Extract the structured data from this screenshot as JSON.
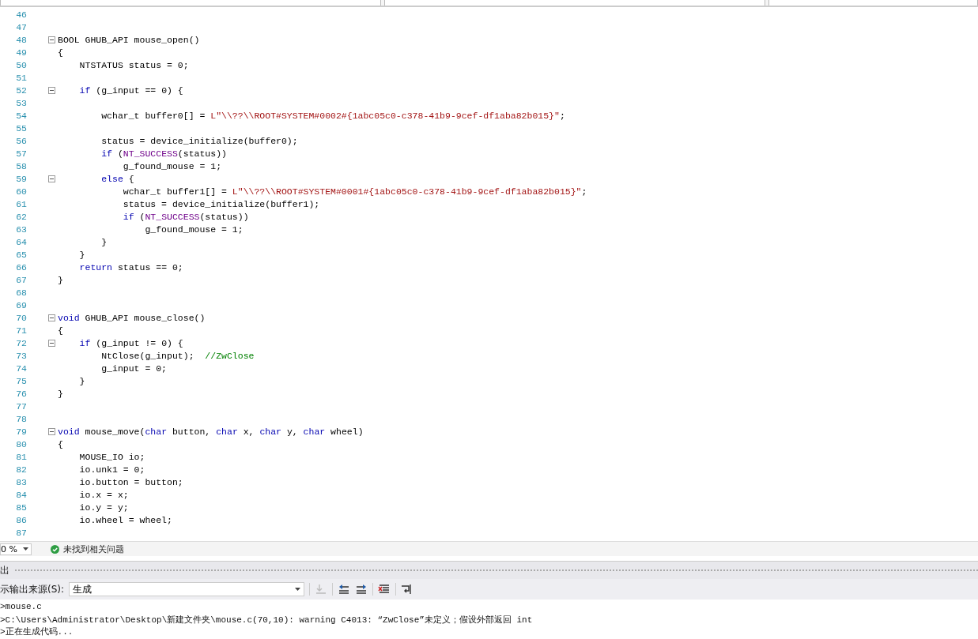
{
  "editor": {
    "lines": [
      {
        "num": "46",
        "fold": false
      },
      {
        "num": "47",
        "fold": false
      },
      {
        "num": "48",
        "fold": true,
        "tokens": [
          {
            "kind": "plain",
            "text": "BOOL GHUB_API mouse_open()"
          }
        ]
      },
      {
        "num": "49",
        "fold": false,
        "tokens": [
          {
            "kind": "plain",
            "text": "{"
          }
        ]
      },
      {
        "num": "50",
        "fold": false,
        "tokens": [
          {
            "kind": "plain",
            "text": "    NTSTATUS status = 0;"
          }
        ]
      },
      {
        "num": "51",
        "fold": false
      },
      {
        "num": "52",
        "fold": true,
        "tokens": [
          {
            "kind": "kw",
            "text": "    if"
          },
          {
            "kind": "plain",
            "text": " (g_input == 0) {"
          }
        ]
      },
      {
        "num": "53",
        "fold": false
      },
      {
        "num": "54",
        "fold": false,
        "tokens": [
          {
            "kind": "plain",
            "text": "        wchar_t buffer0[] = "
          },
          {
            "kind": "str",
            "text": "L\"\\\\??\\\\ROOT#SYSTEM#0002#{1abc05c0-c378-41b9-9cef-df1aba82b015}\""
          },
          {
            "kind": "plain",
            "text": ";"
          }
        ]
      },
      {
        "num": "55",
        "fold": false
      },
      {
        "num": "56",
        "fold": false,
        "tokens": [
          {
            "kind": "plain",
            "text": "        status = device_initialize(buffer0);"
          }
        ]
      },
      {
        "num": "57",
        "fold": false,
        "tokens": [
          {
            "kind": "kw",
            "text": "        if"
          },
          {
            "kind": "plain",
            "text": " ("
          },
          {
            "kind": "macro",
            "text": "NT_SUCCESS"
          },
          {
            "kind": "plain",
            "text": "(status))"
          }
        ]
      },
      {
        "num": "58",
        "fold": false,
        "tokens": [
          {
            "kind": "plain",
            "text": "            g_found_mouse = 1;"
          }
        ]
      },
      {
        "num": "59",
        "fold": true,
        "tokens": [
          {
            "kind": "kw",
            "text": "        else"
          },
          {
            "kind": "plain",
            "text": " {"
          }
        ]
      },
      {
        "num": "60",
        "fold": false,
        "tokens": [
          {
            "kind": "plain",
            "text": "            wchar_t buffer1[] = "
          },
          {
            "kind": "str",
            "text": "L\"\\\\??\\\\ROOT#SYSTEM#0001#{1abc05c0-c378-41b9-9cef-df1aba82b015}\""
          },
          {
            "kind": "plain",
            "text": ";"
          }
        ]
      },
      {
        "num": "61",
        "fold": false,
        "tokens": [
          {
            "kind": "plain",
            "text": "            status = device_initialize(buffer1);"
          }
        ]
      },
      {
        "num": "62",
        "fold": false,
        "tokens": [
          {
            "kind": "kw",
            "text": "            if"
          },
          {
            "kind": "plain",
            "text": " ("
          },
          {
            "kind": "macro",
            "text": "NT_SUCCESS"
          },
          {
            "kind": "plain",
            "text": "(status))"
          }
        ]
      },
      {
        "num": "63",
        "fold": false,
        "tokens": [
          {
            "kind": "plain",
            "text": "                g_found_mouse = 1;"
          }
        ]
      },
      {
        "num": "64",
        "fold": false,
        "tokens": [
          {
            "kind": "plain",
            "text": "        }"
          }
        ]
      },
      {
        "num": "65",
        "fold": false,
        "tokens": [
          {
            "kind": "plain",
            "text": "    }"
          }
        ]
      },
      {
        "num": "66",
        "fold": false,
        "tokens": [
          {
            "kind": "kw",
            "text": "    return"
          },
          {
            "kind": "plain",
            "text": " status == 0;"
          }
        ]
      },
      {
        "num": "67",
        "fold": false,
        "tokens": [
          {
            "kind": "plain",
            "text": "}"
          }
        ]
      },
      {
        "num": "68",
        "fold": false
      },
      {
        "num": "69",
        "fold": false
      },
      {
        "num": "70",
        "fold": true,
        "tokens": [
          {
            "kind": "kw",
            "text": "void"
          },
          {
            "kind": "plain",
            "text": " GHUB_API mouse_close()"
          }
        ]
      },
      {
        "num": "71",
        "fold": false,
        "tokens": [
          {
            "kind": "plain",
            "text": "{"
          }
        ]
      },
      {
        "num": "72",
        "fold": true,
        "tokens": [
          {
            "kind": "kw",
            "text": "    if"
          },
          {
            "kind": "plain",
            "text": " (g_input != 0) {"
          }
        ]
      },
      {
        "num": "73",
        "fold": false,
        "tokens": [
          {
            "kind": "plain",
            "text": "        NtClose(g_input);  "
          },
          {
            "kind": "comment",
            "text": "//ZwClose"
          }
        ]
      },
      {
        "num": "74",
        "fold": false,
        "tokens": [
          {
            "kind": "plain",
            "text": "        g_input = 0;"
          }
        ]
      },
      {
        "num": "75",
        "fold": false,
        "tokens": [
          {
            "kind": "plain",
            "text": "    }"
          }
        ]
      },
      {
        "num": "76",
        "fold": false,
        "tokens": [
          {
            "kind": "plain",
            "text": "}"
          }
        ]
      },
      {
        "num": "77",
        "fold": false
      },
      {
        "num": "78",
        "fold": false
      },
      {
        "num": "79",
        "fold": true,
        "tokens": [
          {
            "kind": "kw",
            "text": "void"
          },
          {
            "kind": "plain",
            "text": " mouse_move("
          },
          {
            "kind": "kw",
            "text": "char"
          },
          {
            "kind": "plain",
            "text": " button, "
          },
          {
            "kind": "kw",
            "text": "char"
          },
          {
            "kind": "plain",
            "text": " x, "
          },
          {
            "kind": "kw",
            "text": "char"
          },
          {
            "kind": "plain",
            "text": " y, "
          },
          {
            "kind": "kw",
            "text": "char"
          },
          {
            "kind": "plain",
            "text": " wheel)"
          }
        ]
      },
      {
        "num": "80",
        "fold": false,
        "tokens": [
          {
            "kind": "plain",
            "text": "{"
          }
        ]
      },
      {
        "num": "81",
        "fold": false,
        "tokens": [
          {
            "kind": "plain",
            "text": "    MOUSE_IO io;"
          }
        ]
      },
      {
        "num": "82",
        "fold": false,
        "tokens": [
          {
            "kind": "plain",
            "text": "    io.unk1 = 0;"
          }
        ]
      },
      {
        "num": "83",
        "fold": false,
        "tokens": [
          {
            "kind": "plain",
            "text": "    io.button = button;"
          }
        ]
      },
      {
        "num": "84",
        "fold": false,
        "tokens": [
          {
            "kind": "plain",
            "text": "    io.x = x;"
          }
        ]
      },
      {
        "num": "85",
        "fold": false,
        "tokens": [
          {
            "kind": "plain",
            "text": "    io.y = y;"
          }
        ]
      },
      {
        "num": "86",
        "fold": false,
        "tokens": [
          {
            "kind": "plain",
            "text": "    io.wheel = wheel;"
          }
        ]
      },
      {
        "num": "87",
        "fold": false
      }
    ]
  },
  "status_bar": {
    "zoom": "0 %",
    "issues": "未找到相关问题"
  },
  "output": {
    "title": "出",
    "source_label": "示输出来源(S):",
    "source_value": "生成",
    "lines": [
      ">mouse.c",
      ">C:\\Users\\Administrator\\Desktop\\新建文件夹\\mouse.c(70,10): warning C4013: “ZwClose”未定义；假设外部返回 int",
      ">正在生成代码..."
    ]
  }
}
